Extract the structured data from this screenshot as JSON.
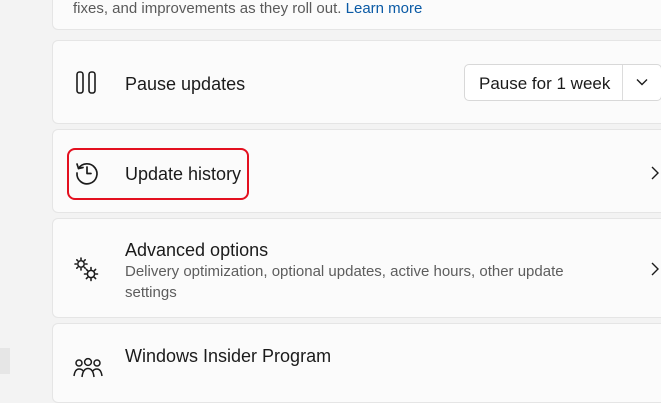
{
  "top_card": {
    "text": "fixes, and improvements as they roll out.",
    "link": "Learn more"
  },
  "pause_updates": {
    "title": "Pause updates",
    "icon": "pause-icon",
    "dropdown_value": "Pause for 1 week"
  },
  "update_history": {
    "title": "Update history",
    "icon": "history-icon",
    "highlight_color": "#e3101f"
  },
  "advanced_options": {
    "title": "Advanced options",
    "subtitle": "Delivery optimization, optional updates, active hours, other update settings",
    "icon": "gears-icon"
  },
  "insider_program": {
    "title": "Windows Insider Program",
    "icon": "people-icon"
  },
  "colors": {
    "link": "#0a5aa5",
    "card_bg": "#fbfbfb",
    "page_bg": "#f3f3f3"
  }
}
